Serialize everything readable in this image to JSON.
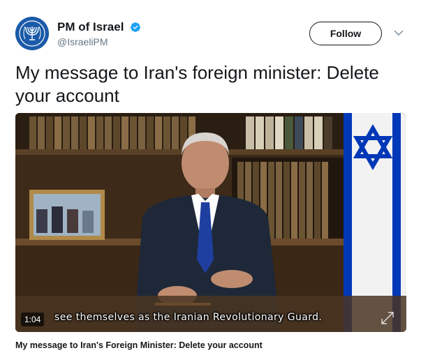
{
  "account": {
    "display_name": "PM of Israel",
    "handle": "@IsraeliPM",
    "verified": true,
    "avatar_icon": "menorah-emblem-icon",
    "avatar_color": "#1a5aa8"
  },
  "actions": {
    "follow_label": "Follow",
    "menu_icon": "chevron-down-icon"
  },
  "tweet": {
    "text": "My message to Iran's foreign minister: Delete your account"
  },
  "video": {
    "subtitle": "see themselves as the Iranian Revolutionary Guard.",
    "timestamp": "1:04",
    "expand_icon": "expand-icon",
    "title": "My message to Iran's Foreign Minister: Delete your account"
  },
  "colors": {
    "text": "#14171a",
    "secondary_text": "#657786",
    "verified_blue": "#1da1f2",
    "flag_blue": "#0038b8"
  }
}
